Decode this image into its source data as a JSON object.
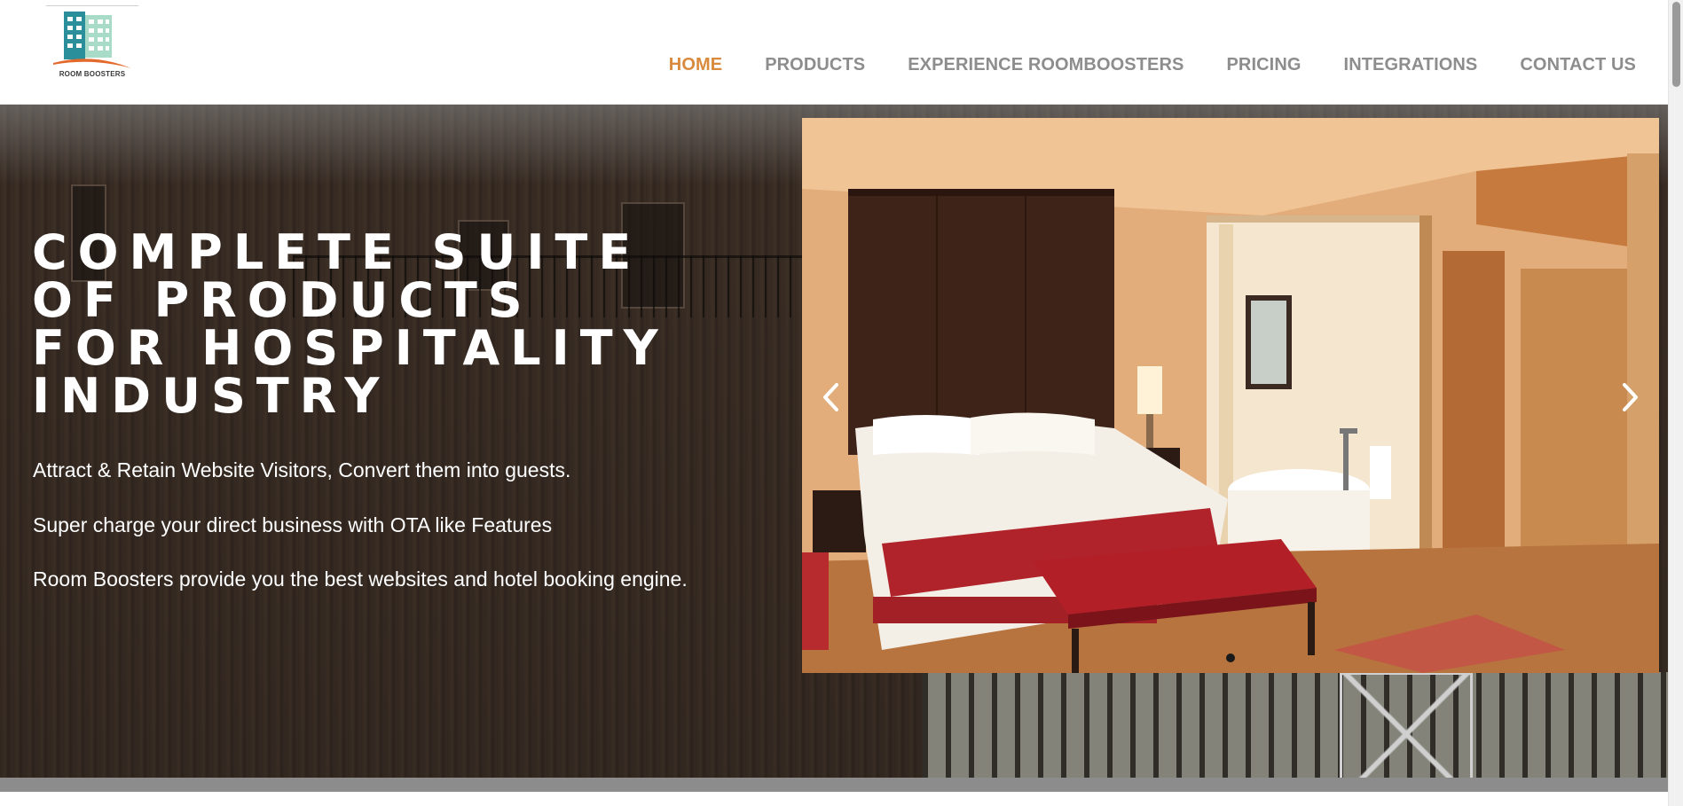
{
  "brand": {
    "logo_text": "ROOM BOOSTERS",
    "colors": {
      "teal": "#2a8f9a",
      "mint": "#9fd7c6",
      "orange": "#e36a2c"
    }
  },
  "nav": {
    "active_color": "#d98a3c",
    "items": [
      {
        "label": "HOME",
        "active": true
      },
      {
        "label": "PRODUCTS"
      },
      {
        "label": "EXPERIENCE ROOMBOOSTERS"
      },
      {
        "label": "PRICING"
      },
      {
        "label": "INTEGRATIONS"
      },
      {
        "label": "CONTACT US"
      }
    ]
  },
  "hero": {
    "title_lines": [
      "COMPLETE SUITE",
      "OF PRODUCTS",
      "FOR HOSPITALITY",
      "INDUSTRY"
    ],
    "lines": [
      "Attract & Retain Website Visitors, Convert them into guests.",
      "Super charge your direct business with OTA like Features",
      "Room Boosters provide you the best websites and hotel booking engine."
    ]
  },
  "slider": {
    "prev_icon": "chevron-left-icon",
    "next_icon": "chevron-right-icon",
    "dot_count": 1,
    "active_dot": 0
  }
}
